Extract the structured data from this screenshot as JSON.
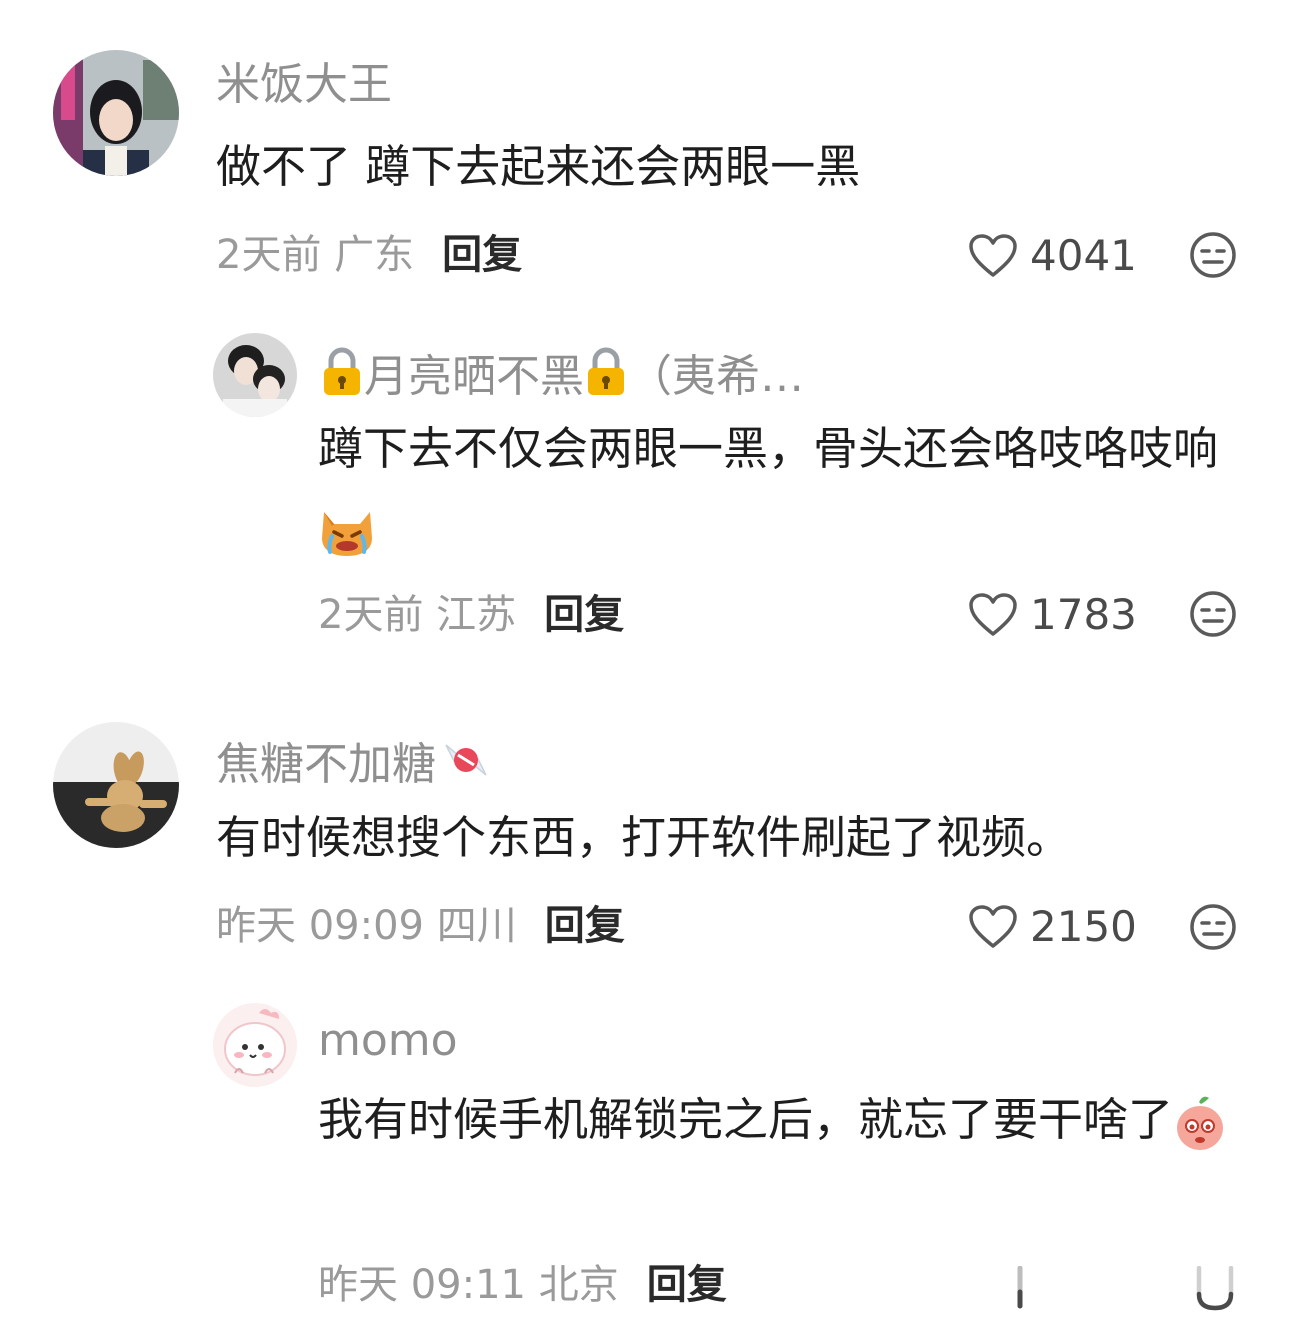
{
  "comments": [
    {
      "user": "米饭大王",
      "text": "做不了 蹲下去起来还会两眼一黑",
      "meta": "2天前 广东",
      "reply_label": "回复",
      "likes": "4041",
      "avatar_icon": "girl-photo-avatar"
    },
    {
      "user_prefix_icon": "lock-emoji",
      "user": "月亮晒不黑",
      "user_suffix": "（夷希…",
      "text": "蹲下去不仅会两眼一黑，骨头还会咯吱咯吱响",
      "text_emoji": "crying-cat-emoji",
      "meta": "2天前 江苏",
      "reply_label": "回复",
      "likes": "1783",
      "avatar_icon": "couple-photo-avatar"
    },
    {
      "user": "焦糖不加糖",
      "user_suffix_icon": "candy-icon",
      "text": "有时候想搜个东西，打开软件刷起了视频。",
      "meta": "昨天 09:09 四川",
      "reply_label": "回复",
      "likes": "2150",
      "avatar_icon": "rabbit-photo-avatar"
    },
    {
      "user": "momo",
      "text": "我有时候手机解锁完之后，就忘了要干啥了",
      "text_emoji": "peach-face-emoji",
      "meta": "昨天 09:11 北京",
      "reply_label": "回复",
      "avatar_icon": "cartoon-dino-avatar"
    }
  ],
  "colors": {
    "name": "#8f8f8f",
    "text": "#1e1e1e",
    "meta": "#9a9a9a"
  }
}
